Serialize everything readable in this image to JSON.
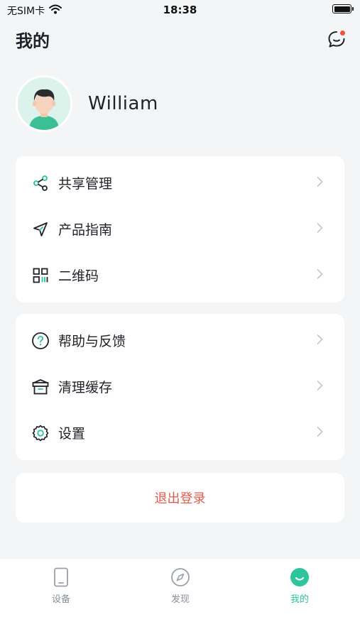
{
  "status_bar": {
    "carrier": "无SIM卡",
    "time": "18:38"
  },
  "header": {
    "title": "我的",
    "message_icon": "chat-bubble-icon",
    "has_unread": true
  },
  "profile": {
    "username": "William",
    "avatar_icon": "user-avatar"
  },
  "menu_group_1": [
    {
      "label": "共享管理",
      "icon": "share-icon"
    },
    {
      "label": "产品指南",
      "icon": "navigation-arrow-icon"
    },
    {
      "label": "二维码",
      "icon": "qrcode-icon"
    }
  ],
  "menu_group_2": [
    {
      "label": "帮助与反馈",
      "icon": "help-icon"
    },
    {
      "label": "清理缓存",
      "icon": "clear-cache-icon"
    },
    {
      "label": "设置",
      "icon": "gear-icon"
    }
  ],
  "logout": {
    "label": "退出登录"
  },
  "tab_bar": {
    "tabs": [
      {
        "label": "设备",
        "icon": "device-icon",
        "active": false
      },
      {
        "label": "发现",
        "icon": "compass-icon",
        "active": false
      },
      {
        "label": "我的",
        "icon": "smile-icon",
        "active": true
      }
    ]
  },
  "colors": {
    "accent": "#2cc59c",
    "danger": "#e55a4b",
    "background": "#f4f5f7",
    "badge": "#f0523e"
  }
}
